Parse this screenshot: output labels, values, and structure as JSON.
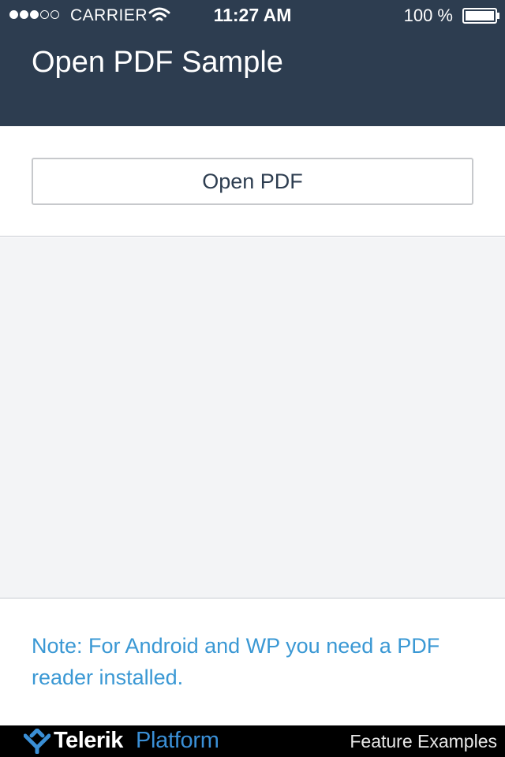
{
  "status_bar": {
    "signal_dots_filled": 3,
    "signal_dots_total": 5,
    "carrier": "CARRIER",
    "time": "11:27 AM",
    "battery_percent": "100 %",
    "battery_level": 1.0
  },
  "header": {
    "title": "Open PDF Sample"
  },
  "main": {
    "open_button_label": "Open PDF"
  },
  "note": {
    "text": "Note: For Android and WP you need a PDF reader installed."
  },
  "footer": {
    "brand_name": "Telerik",
    "brand_product": "Platform",
    "link_label": "Feature Examples"
  },
  "colors": {
    "header_bg": "#2d3d50",
    "content_bg": "#f3f4f6",
    "note_text": "#3a98d4",
    "brand_blue": "#3a8fd6",
    "footer_bg": "#000000"
  },
  "icons": {
    "wifi": "wifi-icon",
    "battery": "battery-icon",
    "logo": "telerik-logo-icon"
  }
}
